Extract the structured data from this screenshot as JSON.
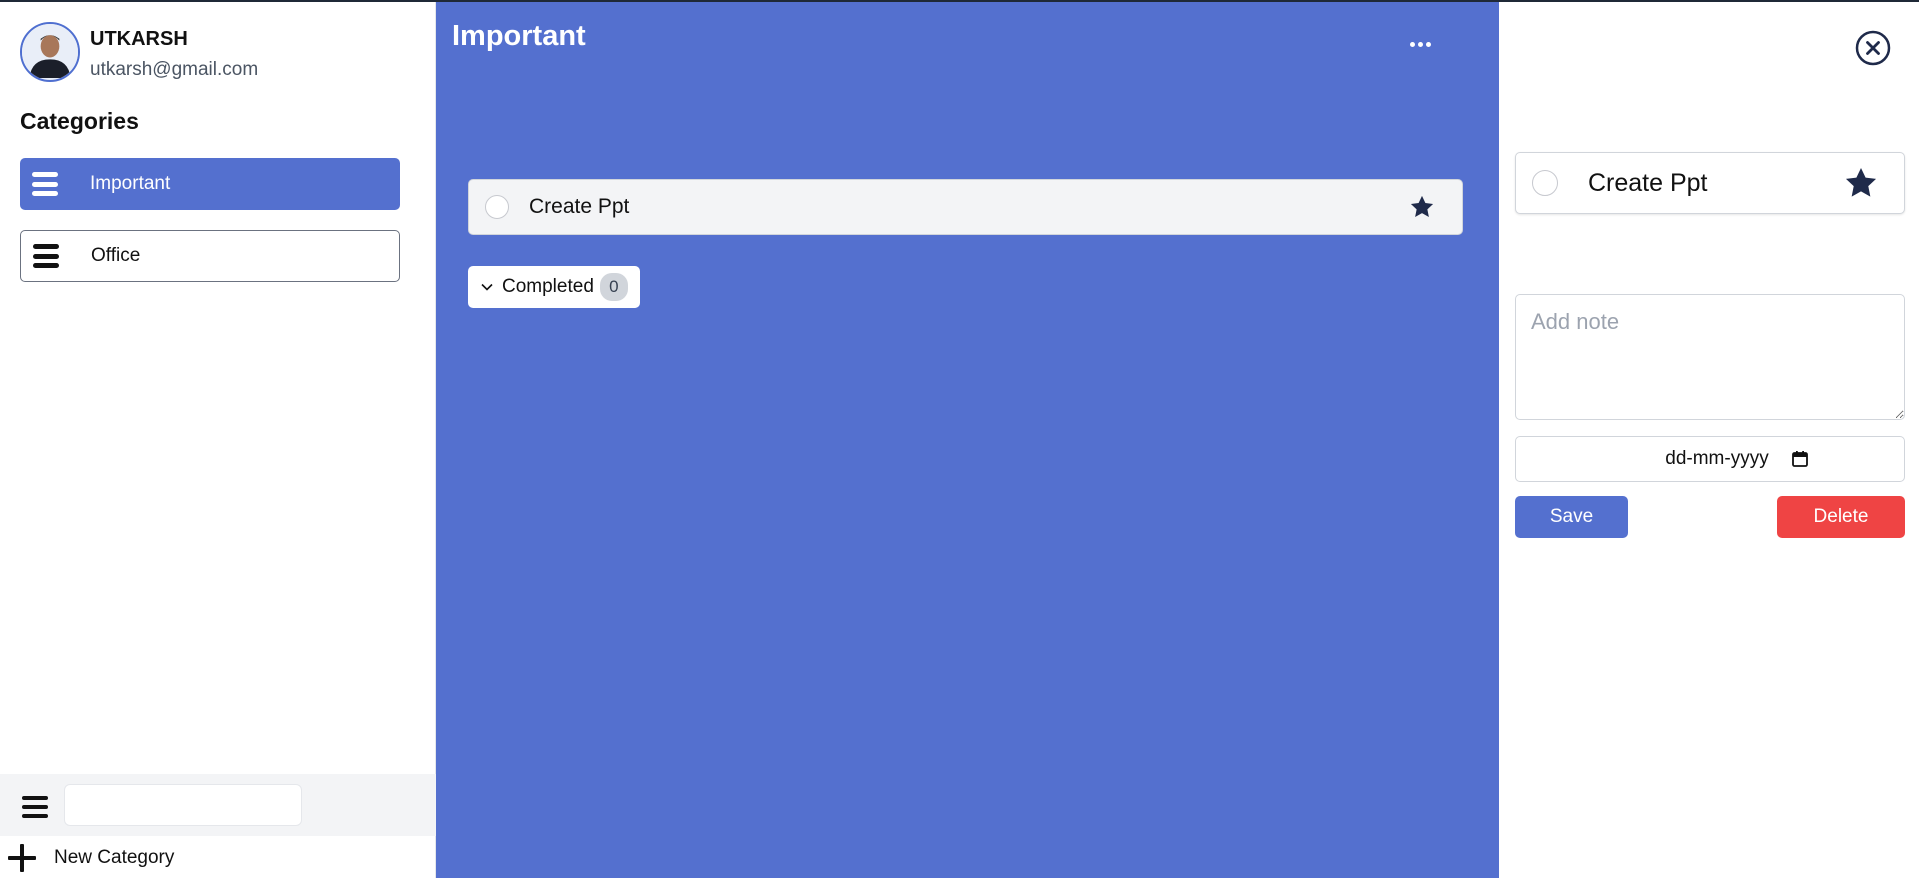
{
  "user": {
    "name": "UTKARSH",
    "email": "utkarsh@gmail.com"
  },
  "sidebar": {
    "categories_title": "Categories",
    "items": [
      {
        "label": "Important",
        "active": true
      },
      {
        "label": "Office",
        "active": false
      }
    ],
    "search_value": "",
    "new_category_label": "New Category"
  },
  "main": {
    "title": "Important",
    "tasks": [
      {
        "text": "Create Ppt",
        "starred": true,
        "done": false
      }
    ],
    "completed_label": "Completed",
    "completed_count": "0"
  },
  "details": {
    "task_text": "Create Ppt",
    "starred": true,
    "note_placeholder": "Add note",
    "note_value": "",
    "date_placeholder": "dd-mm-yyyy",
    "save_label": "Save",
    "delete_label": "Delete"
  },
  "colors": {
    "accent": "#5470cf",
    "danger": "#ef4444",
    "star": "#1f2a4a"
  },
  "icons": {
    "category": "hamburger-icon",
    "star": "star-icon",
    "close": "close-circle-icon",
    "more": "ellipsis-icon",
    "add": "plus-icon",
    "calendar": "calendar-icon",
    "collapse": "chevron-down-icon"
  }
}
